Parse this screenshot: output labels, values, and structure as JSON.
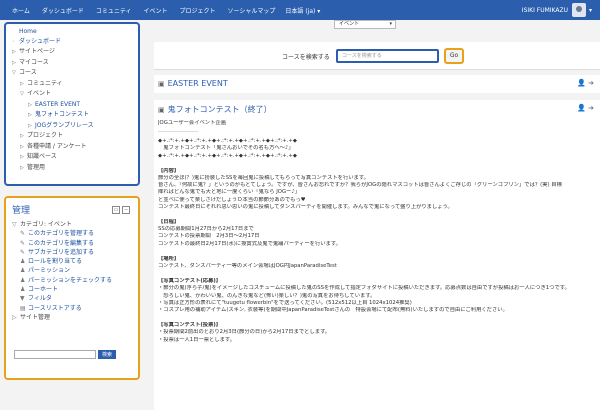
{
  "topbar": {
    "nav": [
      "ホーム",
      "ダッシュボード",
      "コミュニティ",
      "イベント",
      "プロジェクト",
      "ソーシャルマップ"
    ],
    "lang": "日本語 (ja) ▾",
    "user": "ISIKI FUMIKAZU",
    "user_caret": "▾"
  },
  "navigation": {
    "items": [
      {
        "indent": 0,
        "tri": "",
        "label": "Home",
        "style": "link"
      },
      {
        "indent": 0,
        "tri": "◦",
        "label": "ダッシュボード",
        "style": "link"
      },
      {
        "indent": 0,
        "tri": "▷",
        "label": "サイトページ",
        "style": "plain"
      },
      {
        "indent": 0,
        "tri": "▷",
        "label": "マイコース",
        "style": "plain"
      },
      {
        "indent": 0,
        "tri": "▽",
        "label": "コース",
        "style": "plain"
      },
      {
        "indent": 1,
        "tri": "▷",
        "label": "コミュニティ",
        "style": "plain"
      },
      {
        "indent": 1,
        "tri": "▽",
        "label": "イベント",
        "style": "plain"
      },
      {
        "indent": 2,
        "tri": "▷",
        "label": "EASTER EVENT",
        "style": "link"
      },
      {
        "indent": 2,
        "tri": "▷",
        "label": "鬼フォトコンテスト",
        "style": "link"
      },
      {
        "indent": 2,
        "tri": "▷",
        "label": "JOGグランプリレース",
        "style": "link"
      },
      {
        "indent": 1,
        "tri": "▷",
        "label": "プロジェクト",
        "style": "plain"
      },
      {
        "indent": 1,
        "tri": "▷",
        "label": "各種申請 / アンケート",
        "style": "plain"
      },
      {
        "indent": 1,
        "tri": "▷",
        "label": "知識ベース",
        "style": "plain"
      },
      {
        "indent": 1,
        "tri": "▷",
        "label": "管理用",
        "style": "plain"
      }
    ]
  },
  "admin": {
    "title": "管理",
    "items": [
      {
        "indent": 0,
        "ico": "▽",
        "label": "カテゴリ: イベント",
        "style": "plain"
      },
      {
        "indent": 1,
        "ico": "✎",
        "label": "このカテゴリを管理する",
        "style": "link"
      },
      {
        "indent": 1,
        "ico": "✎",
        "label": "このカテゴリを編集する",
        "style": "link"
      },
      {
        "indent": 1,
        "ico": "✎",
        "label": "サブカテゴリを追加する",
        "style": "link"
      },
      {
        "indent": 1,
        "ico": "♟",
        "label": "ロールを割り当てる",
        "style": "link"
      },
      {
        "indent": 1,
        "ico": "♟",
        "label": "パーミッション",
        "style": "link"
      },
      {
        "indent": 1,
        "ico": "♟",
        "label": "パーミッションをチェックする",
        "style": "link"
      },
      {
        "indent": 1,
        "ico": "♟",
        "label": "コーホート",
        "style": "link"
      },
      {
        "indent": 1,
        "ico": "▼",
        "label": "フィルタ",
        "style": "link"
      },
      {
        "indent": 1,
        "ico": "▤",
        "label": "コースリストアする",
        "style": "link"
      },
      {
        "indent": 0,
        "ico": "▷",
        "label": "サイト管理",
        "style": "plain"
      }
    ],
    "search_button": "検索"
  },
  "main": {
    "select_value": "イベント",
    "search_label": "コースを検索する",
    "search_placeholder": "コースを検索する",
    "go_label": "Go",
    "course1_title": "EASTER EVENT",
    "course2_title": "鬼フォトコンテスト（終了）",
    "summary": [
      {
        "t": "JOGユーザー会イベント企画",
        "cls": ""
      },
      {
        "t": "",
        "cls": "hr"
      },
      {
        "t": "◆+.:*:+.+◆+.:*:+.+◆+.:*:+.+◆+.:*:+.+◆+.:*:+.+◆",
        "cls": ""
      },
      {
        "t": "　鬼フォトコンテスト「鬼さんおいでその名も方へ～♪」",
        "cls": ""
      },
      {
        "t": "◆+.:*:+.+◆+.:*:+.+◆+.:*:+.+◆+.:*:+.+◆+.:*:+.+◆",
        "cls": ""
      },
      {
        "t": "",
        "cls": "gap"
      },
      {
        "t": "【内容】",
        "cls": "bold"
      },
      {
        "t": "節分の全ほ(？)鬼に扮装したSSを毎回鬼に投稿してもらって写真コンテストを行います。",
        "cls": ""
      },
      {
        "t": "皆さん、「何故に鬼？」というのがもとてしょう。ですが、皆さんお忘れですか？我らがJOGの隠れマスコットは皆さんよくご存じの「グリーンゴブリン」では？(実) 目標",
        "cls": ""
      },
      {
        "t": "降ればどんな鬼でも大と地に一度くらい「鬼なら JOGー♪」",
        "cls": ""
      },
      {
        "t": "と並べに使って楽しさけだしょうＤ本当の節節分あのでもっ♥",
        "cls": ""
      },
      {
        "t": "コンテスト最終日にそれれ思い思いの鬼に投稿してダンスパーティを開催します。みんなで鬼になって盛り上がりましょう。",
        "cls": ""
      },
      {
        "t": "",
        "cls": "gap"
      },
      {
        "t": "【日程】",
        "cls": "bold"
      },
      {
        "t": "SSの応募期間1月27日から2月17日まで",
        "cls": ""
      },
      {
        "t": "コンテストの投票期間　2月3日～2月17日",
        "cls": ""
      },
      {
        "t": "コンテストの最終日2月17日(水)に授賞式及鬼で鬼踊パーティーを行います。",
        "cls": ""
      },
      {
        "t": "",
        "cls": "gap"
      },
      {
        "t": "【場所】",
        "cls": "bold"
      },
      {
        "t": "コンテスト、ダンスパーティ一等のメイン会場はJOG円JapanParadiseTest",
        "cls": ""
      },
      {
        "t": "",
        "cls": "gap"
      },
      {
        "t": "【写真コンテスト(応募)】",
        "cls": "bold"
      },
      {
        "t": "・節分の鬼(浮ら子/鬼)をイメージしたコスチュームに投稿した鬼のSSを作成して指定フォダサイトに投稿いただきます。応募点数は自由ですが投稿はお一人につき1つです。",
        "cls": ""
      },
      {
        "t": "　恐ろしい鬼、かわいい鬼、のんきな鬼など(怖い)楽しい？)鬼の写真をお待ちしています。",
        "cls": ""
      },
      {
        "t": "・写真は正方形の表れにて\"tuugetu flowerbin\"をで送ってください。(512x512以上目 1024x1024推奨)",
        "cls": ""
      },
      {
        "t": "・コスプレ用の補助アイテム(スキン, 衣装等)を期間中JapanParadiseTestさんの　特設会場にて配布(無料)いたしますので自由にご利用ください。",
        "cls": ""
      },
      {
        "t": "",
        "cls": "gap"
      },
      {
        "t": "【写真コンテスト(投票)】",
        "cls": "bold"
      },
      {
        "t": "・投票期間2前出のとおり2月3日(節分の日)から2月17日までとします。",
        "cls": ""
      },
      {
        "t": "・投票は一人1日一票とします。",
        "cls": ""
      }
    ]
  }
}
